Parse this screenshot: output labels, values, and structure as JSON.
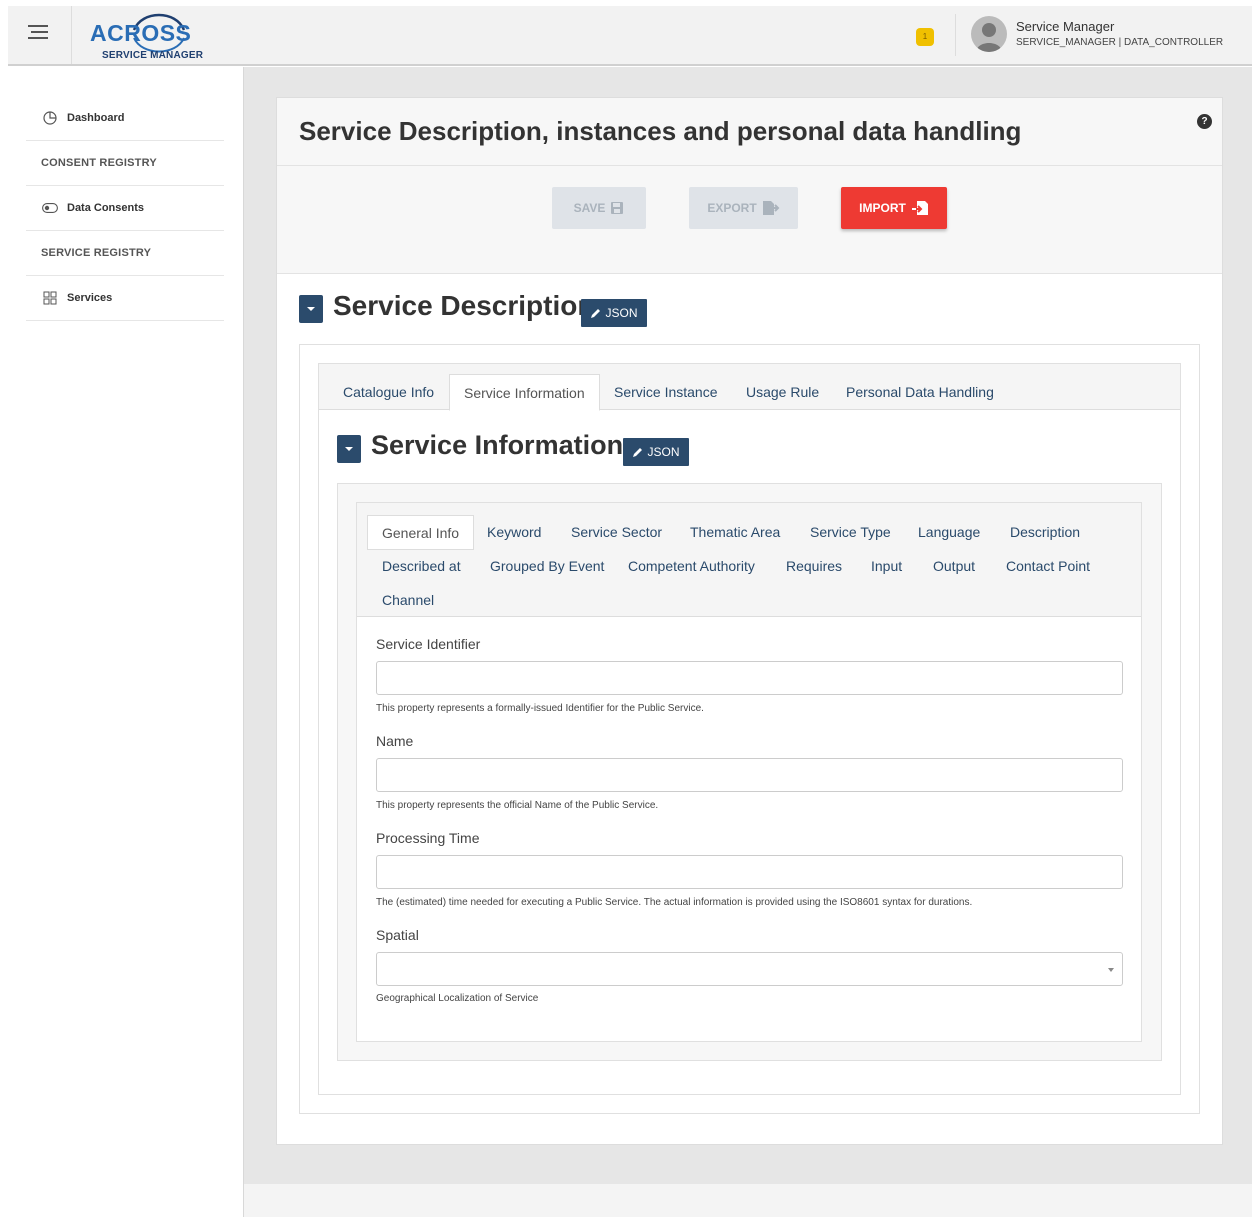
{
  "header": {
    "logo_text": "ACROSS",
    "logo_sub": "SERVICE MANAGER",
    "notification_count": "1",
    "user_name": "Service Manager",
    "user_roles": "SERVICE_MANAGER | DATA_CONTROLLER"
  },
  "sidebar": {
    "items": [
      {
        "label": "Dashboard",
        "icon": "pie-chart-icon"
      },
      {
        "label": "CONSENT REGISTRY"
      },
      {
        "label": "Data Consents",
        "icon": "toggle-icon"
      },
      {
        "label": "SERVICE REGISTRY"
      },
      {
        "label": "Services",
        "icon": "grid-icon"
      }
    ]
  },
  "page": {
    "title": "Service Description, instances and personal data handling",
    "help_icon": "?"
  },
  "toolbar": {
    "save_label": "SAVE",
    "export_label": "EXPORT",
    "import_label": "IMPORT"
  },
  "service_description": {
    "title": "Service Description",
    "json_label": "JSON",
    "tabs": [
      "Catalogue Info",
      "Service Information",
      "Service Instance",
      "Usage Rule",
      "Personal Data Handling"
    ],
    "active_tab": "Service Information"
  },
  "service_information": {
    "title": "Service Information",
    "json_label": "JSON",
    "tabs_row1": [
      "General Info",
      "Keyword",
      "Service Sector",
      "Thematic Area",
      "Service Type",
      "Language",
      "Description"
    ],
    "tabs_row2": [
      "Described at",
      "Grouped By Event",
      "Competent Authority",
      "Requires",
      "Input",
      "Output",
      "Contact Point"
    ],
    "tabs_row3": [
      "Channel"
    ],
    "active_tab": "General Info"
  },
  "form": {
    "fields": [
      {
        "label": "Service Identifier",
        "value": "",
        "help": "This property represents a formally-issued Identifier for the Public Service."
      },
      {
        "label": "Name",
        "value": "",
        "help": "This property represents the official Name of the Public Service."
      },
      {
        "label": "Processing Time",
        "value": "",
        "help": "The (estimated) time needed for executing a Public Service. The actual information is provided using the ISO8601 syntax for durations."
      },
      {
        "label": "Spatial",
        "value": "",
        "help": "Geographical Localization of Service"
      }
    ]
  },
  "colors": {
    "primary_dark": "#2b4b6c",
    "import_red": "#ee3a33",
    "logo_blue": "#2a6db5",
    "disabled": "#dfe3e8"
  }
}
